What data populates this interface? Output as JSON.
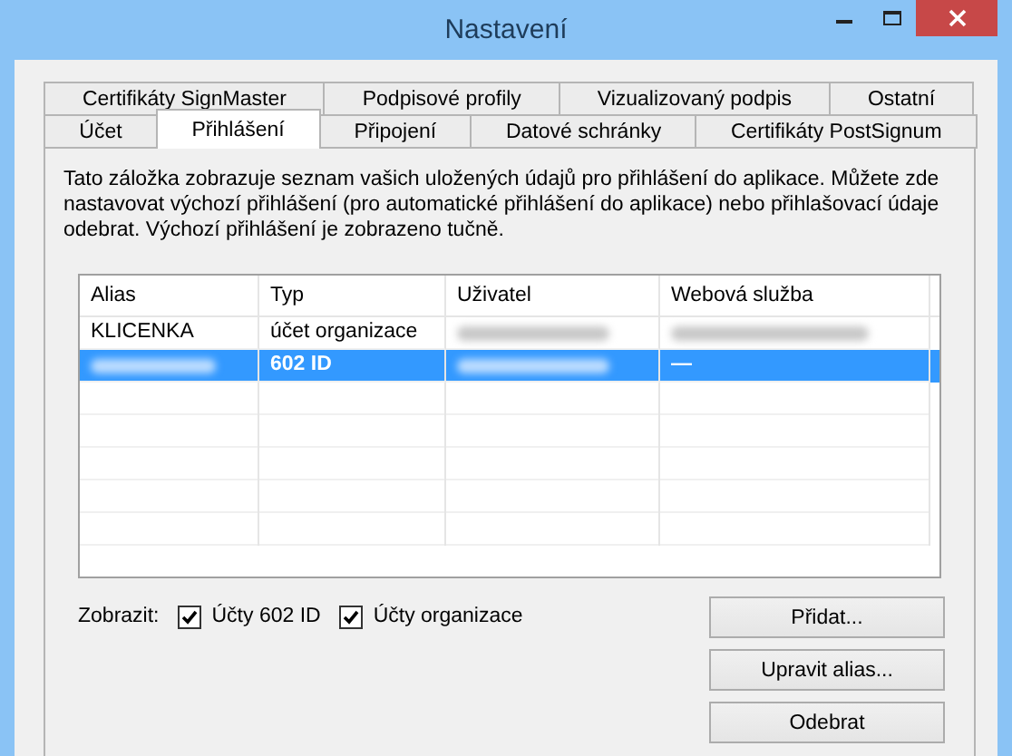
{
  "window": {
    "title": "Nastavení"
  },
  "tab_rows": [
    [
      {
        "label": "Certifikáty SignMaster",
        "selected": false
      },
      {
        "label": "Podpisové profily",
        "selected": false
      },
      {
        "label": "Vizualizovaný podpis",
        "selected": false
      },
      {
        "label": "Ostatní",
        "selected": false
      }
    ],
    [
      {
        "label": "Účet",
        "selected": false
      },
      {
        "label": "Přihlášení",
        "selected": true
      },
      {
        "label": "Připojení",
        "selected": false
      },
      {
        "label": "Datové schránky",
        "selected": false
      },
      {
        "label": "Certifikáty PostSignum",
        "selected": false
      }
    ]
  ],
  "description": "Tato záložka zobrazuje seznam vašich uložených údajů pro přihlášení do aplikace. Můžete zde nastavovat výchozí přihlášení (pro automatické přihlášení do aplikace) nebo přihlašovací údaje odebrat. Výchozí přihlášení je zobrazeno tučně.",
  "table": {
    "columns": [
      "Alias",
      "Typ",
      "Uživatel",
      "Webová služba"
    ],
    "rows": [
      {
        "selected": false,
        "default": false,
        "cells": [
          {
            "kind": "text",
            "text": "KLICENKA"
          },
          {
            "kind": "text",
            "text": "účet organizace"
          },
          {
            "kind": "redacted"
          },
          {
            "kind": "redacted"
          }
        ]
      },
      {
        "selected": true,
        "default": true,
        "cells": [
          {
            "kind": "redacted"
          },
          {
            "kind": "text",
            "text": "602 ID"
          },
          {
            "kind": "redacted"
          },
          {
            "kind": "text",
            "text": "—"
          }
        ]
      }
    ]
  },
  "filter": {
    "label": "Zobrazit:",
    "options": [
      {
        "label": "Účty 602 ID",
        "checked": true
      },
      {
        "label": "Účty organizace",
        "checked": true
      }
    ]
  },
  "buttons": [
    "Přidat...",
    "Upravit alias...",
    "Odebrat"
  ]
}
